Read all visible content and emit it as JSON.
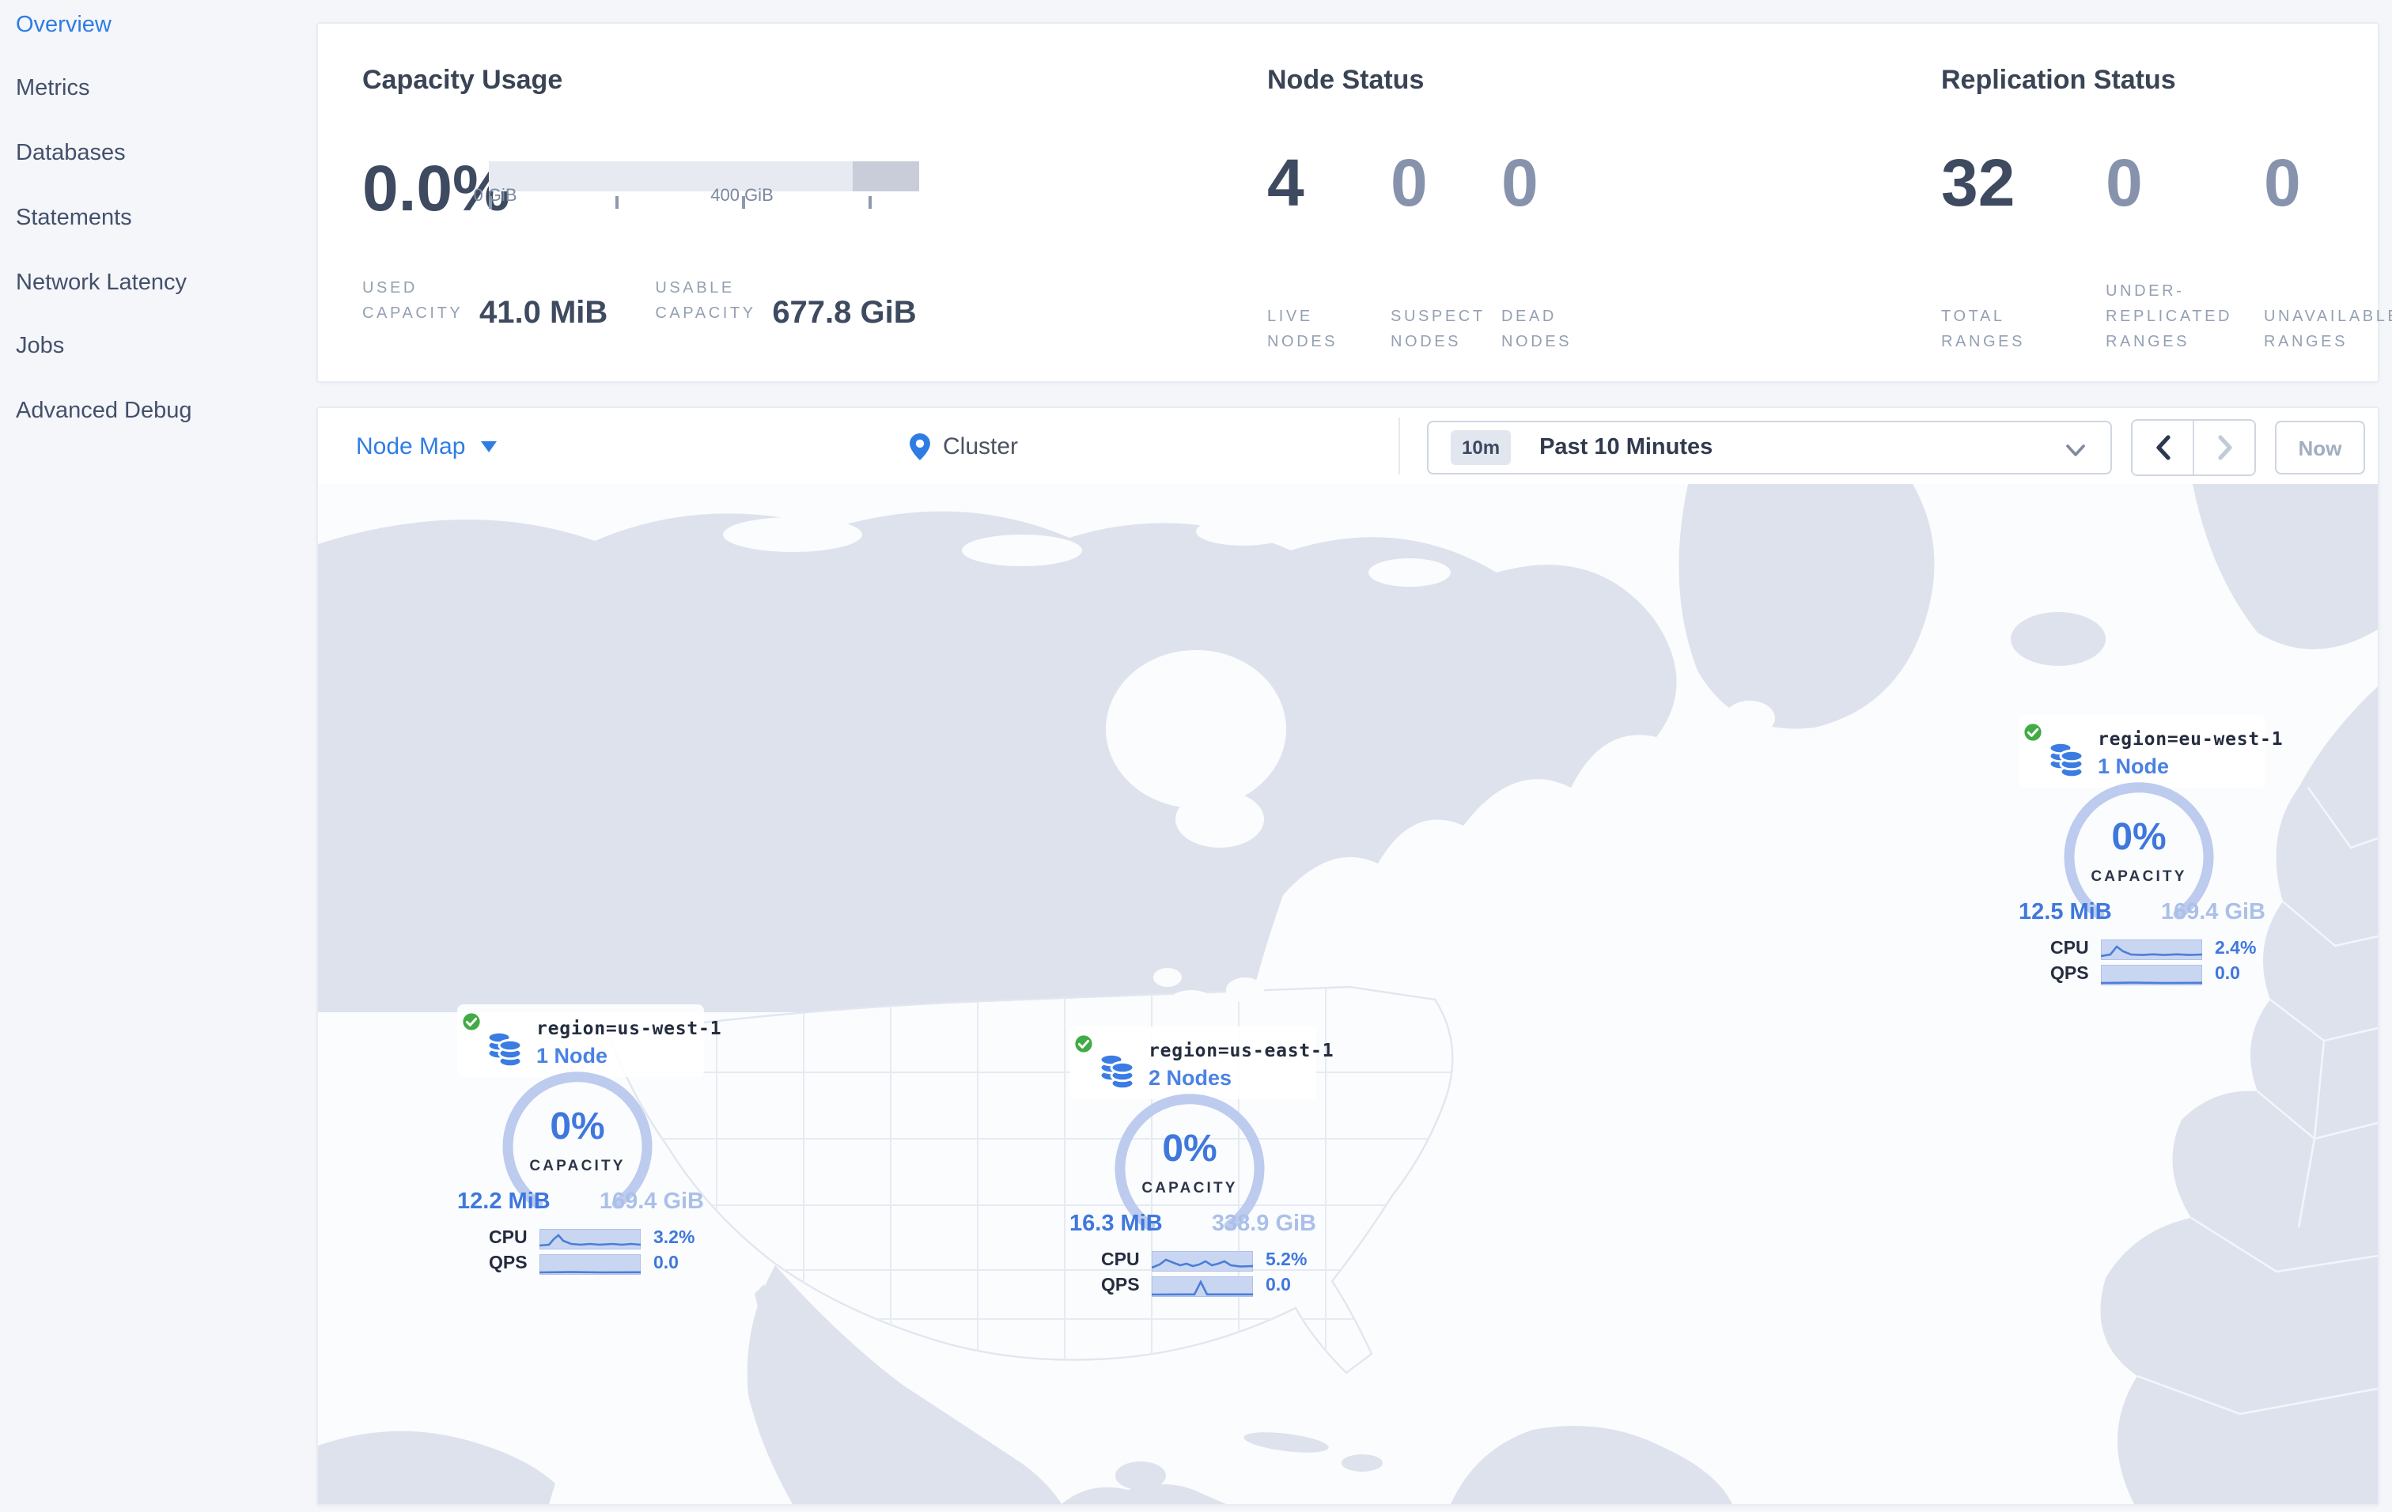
{
  "sidebar": {
    "items": [
      {
        "label": "Overview",
        "active": true
      },
      {
        "label": "Metrics",
        "active": false
      },
      {
        "label": "Databases",
        "active": false
      },
      {
        "label": "Statements",
        "active": false
      },
      {
        "label": "Network Latency",
        "active": false
      },
      {
        "label": "Jobs",
        "active": false
      },
      {
        "label": "Advanced Debug",
        "active": false
      }
    ]
  },
  "capacity": {
    "title": "Capacity Usage",
    "percent": "0.0%",
    "tick_labels": [
      "0 GiB",
      "400 GiB"
    ],
    "axis": {
      "min_gib": 0,
      "tick_step_gib": 200,
      "max_gib": 677.8
    },
    "used_label": "USED CAPACITY",
    "used_value": "41.0 MiB",
    "usable_label": "USABLE CAPACITY",
    "usable_value": "677.8 GiB"
  },
  "nodes": {
    "title": "Node Status",
    "stats": [
      {
        "value": "4",
        "label": "LIVE NODES"
      },
      {
        "value": "0",
        "label": "SUSPECT NODES"
      },
      {
        "value": "0",
        "label": "DEAD NODES"
      }
    ]
  },
  "replication": {
    "title": "Replication Status",
    "stats": [
      {
        "value": "32",
        "label": "TOTAL RANGES"
      },
      {
        "value": "0",
        "label": "UNDER-REPLICATED RANGES"
      },
      {
        "value": "0",
        "label": "UNAVAILABLE RANGES"
      }
    ]
  },
  "toolbar": {
    "view_label": "Node Map",
    "breadcrumb": "Cluster",
    "time_badge": "10m",
    "time_range": "Past 10 Minutes",
    "now_label": "Now"
  },
  "map": {
    "markers": [
      {
        "region": "region=us-west-1",
        "nodes": "1 Node",
        "percent": "0%",
        "capacity_label": "CAPACITY",
        "used": "12.2 MiB",
        "total": "169.4 GiB",
        "cpu_label": "CPU",
        "cpu_value": "3.2%",
        "qps_label": "QPS",
        "qps_value": "0.0"
      },
      {
        "region": "region=us-east-1",
        "nodes": "2 Nodes",
        "percent": "0%",
        "capacity_label": "CAPACITY",
        "used": "16.3 MiB",
        "total": "338.9 GiB",
        "cpu_label": "CPU",
        "cpu_value": "5.2%",
        "qps_label": "QPS",
        "qps_value": "0.0"
      },
      {
        "region": "region=eu-west-1",
        "nodes": "1 Node",
        "percent": "0%",
        "capacity_label": "CAPACITY",
        "used": "12.5 MiB",
        "total": "169.4 GiB",
        "cpu_label": "CPU",
        "cpu_value": "2.4%",
        "qps_label": "QPS",
        "qps_value": "0.0"
      }
    ]
  },
  "icons": {
    "node-map-caret": "caret-down",
    "breadcrumb-pin": "location-pin",
    "time-chevron": "chevron-down",
    "prev": "chevron-left",
    "next": "chevron-right",
    "marker-health": "green-check-circle",
    "marker-db": "database-stack"
  },
  "colors": {
    "accent_blue": "#2f7de3",
    "value_blue": "#3f78dd",
    "dark_text": "#3e4a5f",
    "muted_stat": "#8793ad",
    "label_gray": "#94a0b3",
    "healthy_green": "#41ab46",
    "gauge_arc": "#bccbee",
    "land_gray": "#dde2ec",
    "page_bg": "#f4f6fa"
  }
}
